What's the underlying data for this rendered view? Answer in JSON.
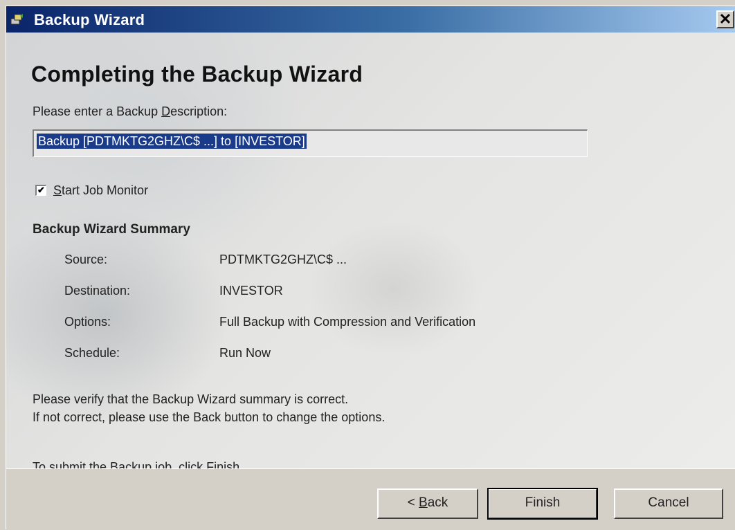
{
  "window": {
    "title": "Backup Wizard",
    "close_label": "✕"
  },
  "main": {
    "heading": "Completing the Backup Wizard",
    "description_label_pre": "Please enter a Backup ",
    "description_label_key": "D",
    "description_label_post": "escription:",
    "description_value": "Backup [PDTMKTG2GHZ\\C$ ...] to [INVESTOR]",
    "start_job_monitor": {
      "checked": true,
      "check_glyph": "✔",
      "label_key": "S",
      "label_rest": "tart Job Monitor"
    },
    "summary": {
      "heading": "Backup Wizard Summary",
      "rows": [
        {
          "key": "Source:",
          "value": "PDTMKTG2GHZ\\C$ ..."
        },
        {
          "key": "Destination:",
          "value": "INVESTOR"
        },
        {
          "key": "Options:",
          "value": "Full Backup with Compression and Verification"
        },
        {
          "key": "Schedule:",
          "value": "Run Now"
        }
      ]
    },
    "notes": {
      "verify_line1": "Please verify that the Backup Wizard summary is correct.",
      "verify_line2": "If not correct, please use the Back button to change the options.",
      "submit_line": "To submit the Backup job, click Finish."
    }
  },
  "footer": {
    "back_prefix": "< ",
    "back_key": "B",
    "back_rest": "ack",
    "finish_label": "Finish",
    "cancel_label": "Cancel"
  }
}
